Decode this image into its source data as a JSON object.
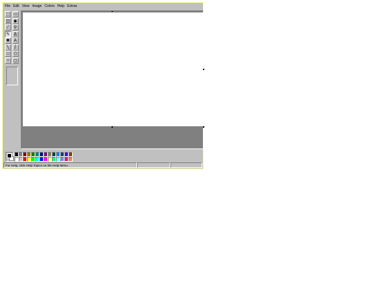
{
  "menu": [
    "File",
    "Edit",
    "View",
    "Image",
    "Colors",
    "Help",
    "Extras"
  ],
  "tools": [
    {
      "name": "free-select",
      "glyph": "⬚"
    },
    {
      "name": "rect-select",
      "glyph": "▭"
    },
    {
      "name": "eraser",
      "glyph": "◫"
    },
    {
      "name": "fill",
      "glyph": "◆"
    },
    {
      "name": "color-picker",
      "glyph": "⁄"
    },
    {
      "name": "magnifier",
      "glyph": "⚲"
    },
    {
      "name": "pencil",
      "glyph": "✎"
    },
    {
      "name": "brush",
      "glyph": "ᐃ"
    },
    {
      "name": "airbrush",
      "glyph": "✺"
    },
    {
      "name": "text",
      "glyph": "A"
    },
    {
      "name": "line",
      "glyph": "╲"
    },
    {
      "name": "curve",
      "glyph": "∫"
    },
    {
      "name": "rectangle",
      "glyph": "□"
    },
    {
      "name": "polygon",
      "glyph": "⬠"
    },
    {
      "name": "ellipse",
      "glyph": "○"
    },
    {
      "name": "rounded-rectangle",
      "glyph": "▢"
    }
  ],
  "active_tool": "pencil",
  "palette": {
    "foreground": "#000000",
    "background": "#ffffff",
    "row1": [
      "#000000",
      "#808080",
      "#800000",
      "#808000",
      "#008000",
      "#008080",
      "#000080",
      "#800080",
      "#808040",
      "#004040",
      "#0080ff",
      "#004080",
      "#4000ff",
      "#804000"
    ],
    "row2": [
      "#ffffff",
      "#c0c0c0",
      "#ff0000",
      "#ffff00",
      "#00ff00",
      "#00ffff",
      "#0000ff",
      "#ff00ff",
      "#ffff80",
      "#00ff80",
      "#80ffff",
      "#8080ff",
      "#ff0080",
      "#ff8040"
    ]
  },
  "status": {
    "help_text": "For Help, click Help Topics on the Help Menu.",
    "coords": "",
    "size": ""
  }
}
